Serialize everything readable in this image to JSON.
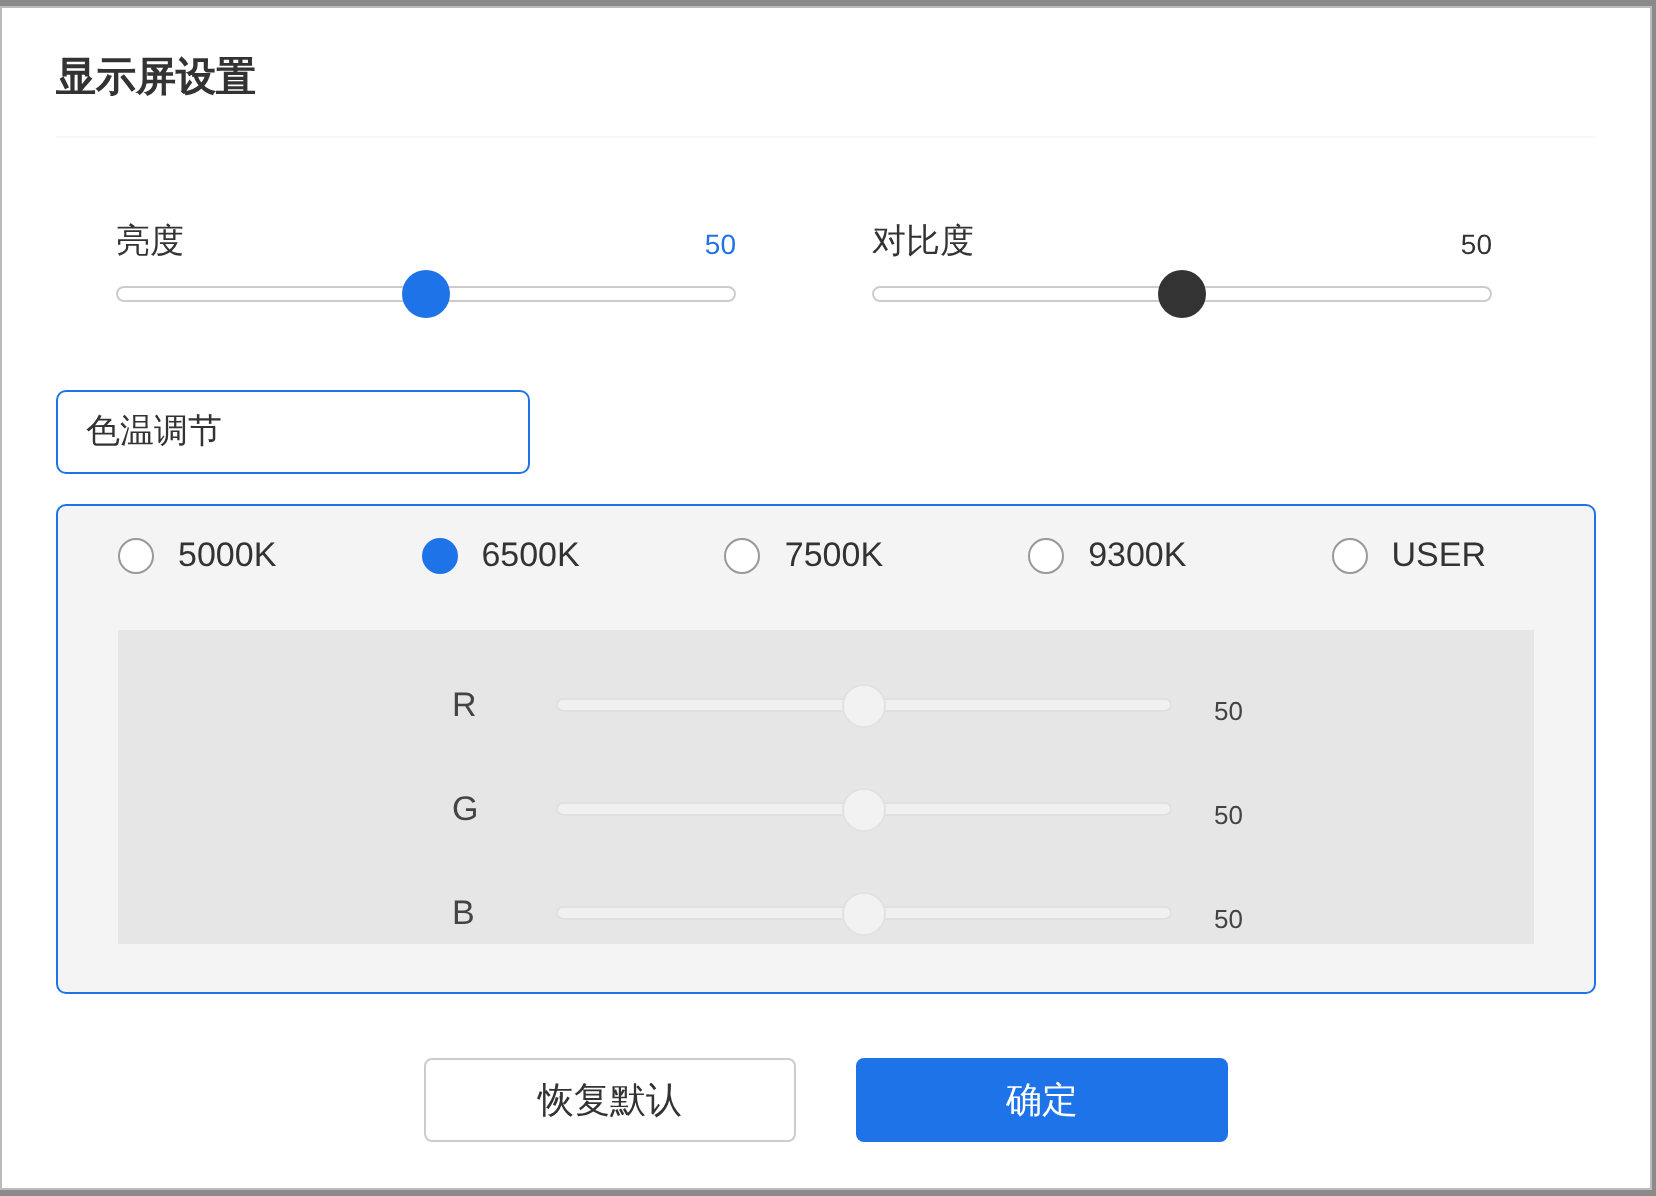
{
  "dialog": {
    "title": "显示屏设置"
  },
  "sliders": [
    {
      "label": "亮度",
      "reading": "50",
      "level": 0.5,
      "active": true
    },
    {
      "label": "对比度",
      "reading": "50",
      "level": 0.5,
      "active": false
    }
  ],
  "color_temperature": {
    "label": "色温调节",
    "presets": [
      {
        "label": "5000K",
        "selected": false
      },
      {
        "label": "6500K",
        "selected": true
      },
      {
        "label": "7500K",
        "selected": false
      },
      {
        "label": "9300K",
        "selected": false
      },
      {
        "label": "USER",
        "selected": false
      }
    ],
    "rgb_disabled": true,
    "channels": [
      {
        "label": "R",
        "level": 0.5,
        "reading": "50"
      },
      {
        "label": "G",
        "level": 0.5,
        "reading": "50"
      },
      {
        "label": "B",
        "level": 0.5,
        "reading": "50"
      }
    ]
  },
  "buttons": [
    {
      "label": "恢复默认",
      "kind": "secondary"
    },
    {
      "label": "确定",
      "kind": "primary"
    }
  ]
}
